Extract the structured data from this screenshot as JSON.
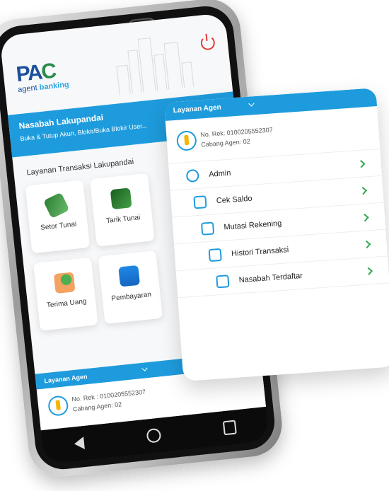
{
  "brand": {
    "logo_primary": "PA",
    "logo_secondary": "C",
    "tag_prefix": "agent",
    "tag_suffix": "banking",
    "colors": {
      "primary": "#1e9bdc",
      "green": "#2fa84f",
      "navy": "#1b4f9c",
      "danger": "#e53935"
    }
  },
  "banner": {
    "title": "Nasabah Lakupandai",
    "subtitle": "Buka & Tutup Akun, Blokir/Buka Blokir User..."
  },
  "services": {
    "title": "Layanan Transaksi Lakupandai",
    "items": [
      {
        "label": "Setor Tunai",
        "icon": "cash-deposit-icon"
      },
      {
        "label": "Tarik Tunai",
        "icon": "atm-withdraw-icon"
      },
      {
        "label": "Terima Uang",
        "icon": "receive-money-icon"
      },
      {
        "label": "Pembayaran",
        "icon": "wallet-icon"
      }
    ]
  },
  "agent": {
    "header": "Layanan Agen",
    "account_phone": "No. Rek : 0100205552307",
    "branch_phone": "Cabang Agen: 02",
    "account_panel": "No. Rek: 0100205552307",
    "branch_panel": "Cabang Agen: 02"
  },
  "panel": {
    "title": "Layanan Agen",
    "menu": [
      {
        "label": "Admin",
        "icon": "user-icon"
      },
      {
        "label": "Cek Saldo",
        "icon": "wallet-icon"
      },
      {
        "label": "Mutasi Rekening",
        "icon": "document-icon"
      },
      {
        "label": "Histori Transaksi",
        "icon": "history-icon"
      },
      {
        "label": "Nasabah Terdaftar",
        "icon": "registered-customer-icon"
      }
    ]
  }
}
